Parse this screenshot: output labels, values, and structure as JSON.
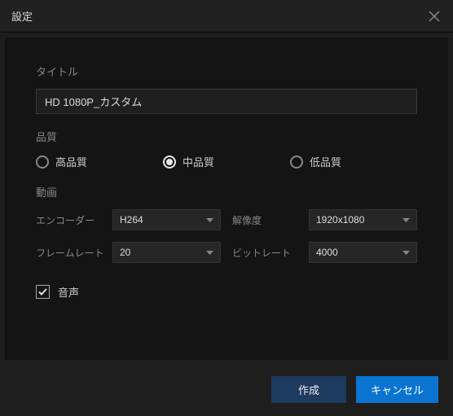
{
  "header": {
    "title": "設定"
  },
  "sections": {
    "title_label": "タイトル",
    "title_value": "HD 1080P_カスタム",
    "quality_label": "品質",
    "quality_options": {
      "high": "高品質",
      "mid": "中品質",
      "low": "低品質"
    },
    "quality_selected": "mid",
    "video_label": "動画",
    "encoder_label": "エンコーダー",
    "encoder_value": "H264",
    "resolution_label": "解像度",
    "resolution_value": "1920x1080",
    "framerate_label": "フレームレート",
    "framerate_value": "20",
    "bitrate_label": "ビットレート",
    "bitrate_value": "4000",
    "audio_label": "音声",
    "audio_checked": true
  },
  "footer": {
    "create": "作成",
    "cancel": "キャンセル"
  }
}
